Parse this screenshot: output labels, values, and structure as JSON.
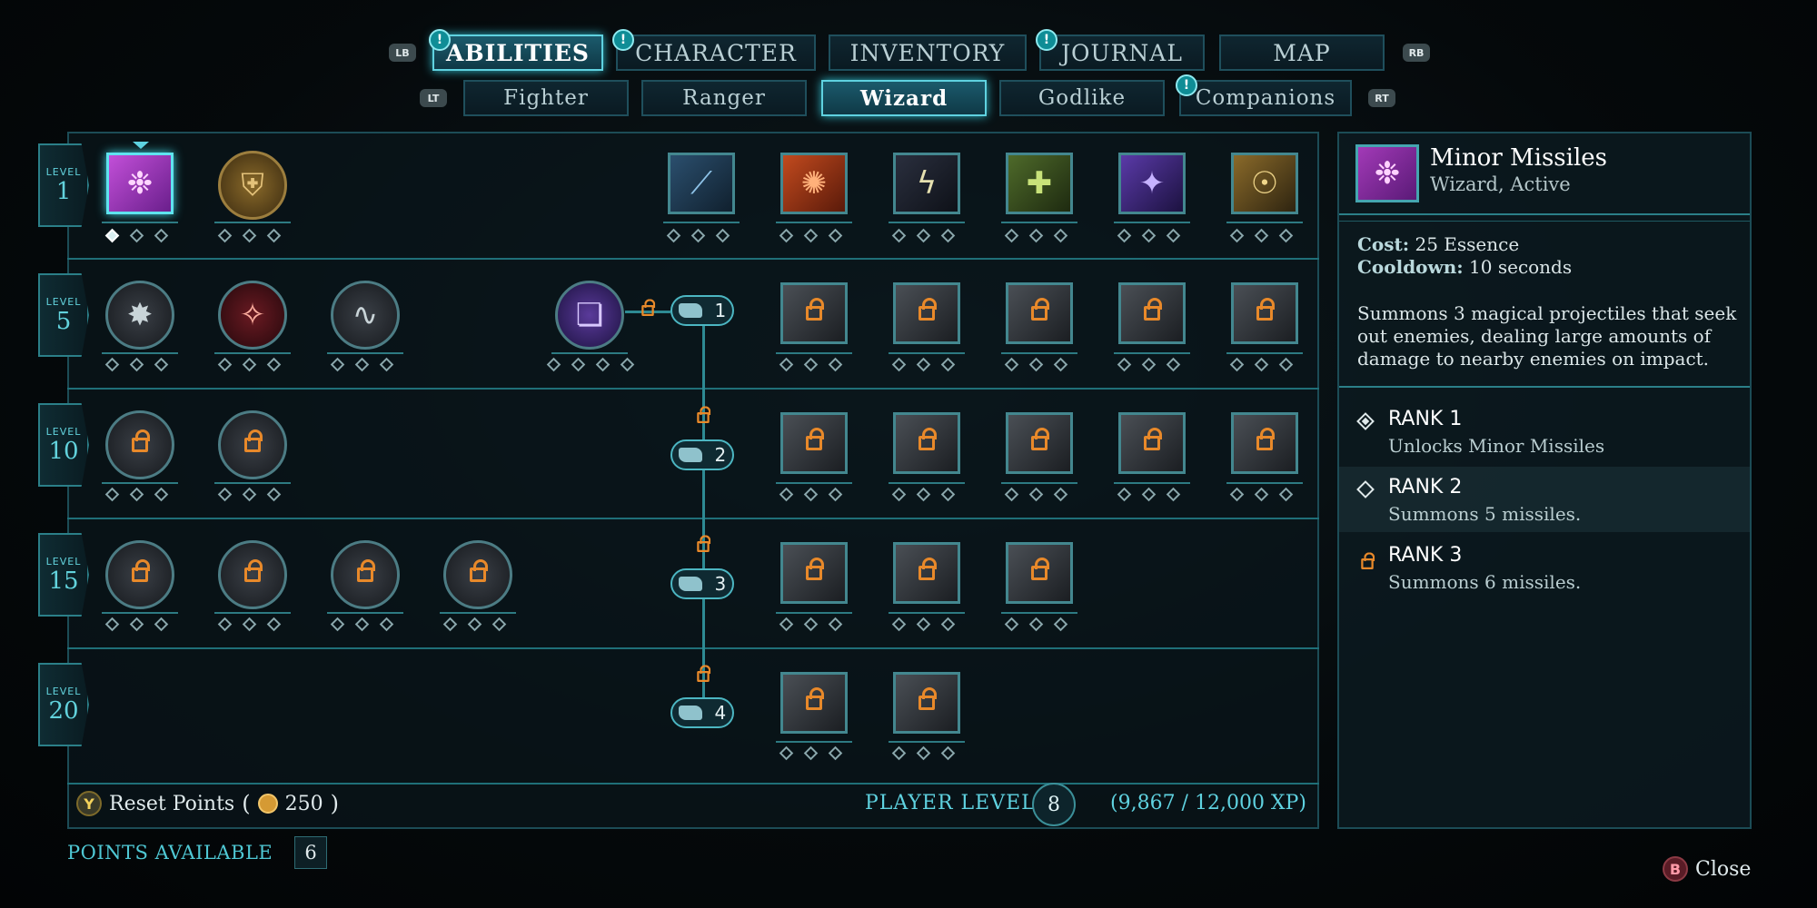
{
  "tabs": {
    "lb": "LB",
    "rb": "RB",
    "lt": "LT",
    "rt": "RT",
    "main": [
      {
        "label": "ABILITIES",
        "badge": "!"
      },
      {
        "label": "CHARACTER",
        "badge": "!"
      },
      {
        "label": "INVENTORY",
        "badge": ""
      },
      {
        "label": "JOURNAL",
        "badge": "!"
      },
      {
        "label": "MAP",
        "badge": ""
      }
    ],
    "sub": [
      {
        "label": "Fighter",
        "badge": ""
      },
      {
        "label": "Ranger",
        "badge": ""
      },
      {
        "label": "Wizard",
        "badge": ""
      },
      {
        "label": "Godlike",
        "badge": ""
      },
      {
        "label": "Companions",
        "badge": "!"
      }
    ]
  },
  "grid": {
    "level_word": "LEVEL",
    "levels": [
      "1",
      "5",
      "10",
      "15",
      "20"
    ],
    "tiers": [
      "1",
      "2",
      "3",
      "4"
    ]
  },
  "footer": {
    "y_button": "Y",
    "reset_label": "Reset Points",
    "reset_value": "250",
    "player_level_label": "PLAYER LEVEL",
    "player_level": "8",
    "xp": "(9,867 / 12,000 XP)",
    "points_label": "POINTS AVAILABLE",
    "points_value": "6",
    "b_button": "B",
    "close_label": "Close"
  },
  "detail": {
    "title": "Minor Missiles",
    "subtitle": "Wizard, Active",
    "cost_label": "Cost:",
    "cost_value": "25 Essence",
    "cooldown_label": "Cooldown:",
    "cooldown_value": "10 seconds",
    "description_lines": [
      "Summons 3 magical projectiles that seek",
      "out enemies, dealing large amounts of",
      "damage to nearby enemies on impact."
    ],
    "ranks": [
      {
        "title": "RANK 1",
        "desc": "Unlocks Minor Missiles",
        "state": "unlocked"
      },
      {
        "title": "RANK 2",
        "desc": "Summons 5 missiles.",
        "state": "available"
      },
      {
        "title": "RANK 3",
        "desc": "Summons 6 missiles.",
        "state": "locked"
      }
    ]
  },
  "colors": {
    "accent": "#5fd2e0",
    "lock": "#e8892a",
    "background": "#05090b"
  }
}
